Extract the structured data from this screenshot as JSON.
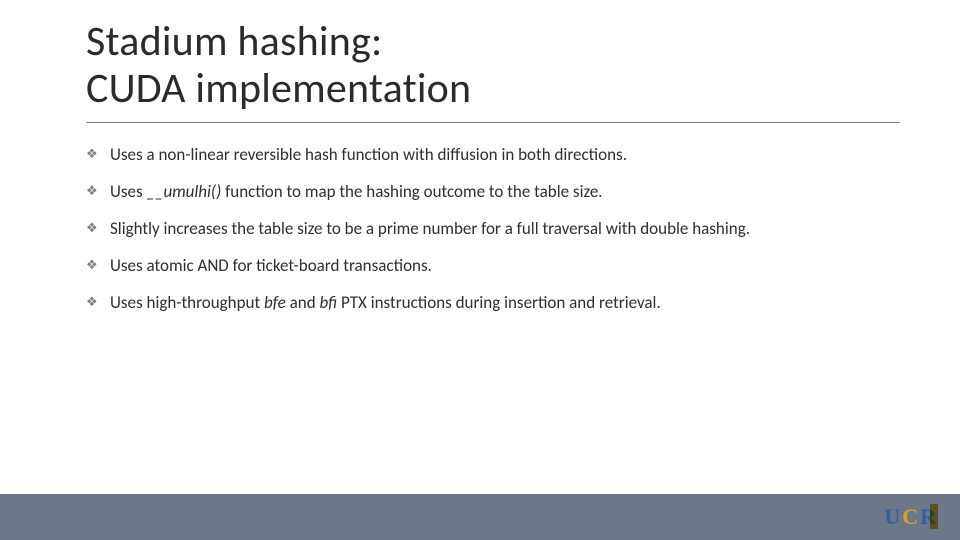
{
  "title": {
    "line1": "Stadium hashing:",
    "line2": "CUDA implementation"
  },
  "bullets": [
    {
      "prefix": "Uses a non-linear reversible hash function with diffusion in both directions."
    },
    {
      "prefix": "Uses ",
      "italic1": "__umulhi()",
      "mid": " function to map the hashing outcome to the table size."
    },
    {
      "prefix": "Slightly increases the table size to be a prime number for a full traversal with double hashing."
    },
    {
      "prefix": "Uses atomic AND for ticket-board transactions."
    },
    {
      "prefix": "Uses high-throughput ",
      "italic1": "bfe",
      "mid": " and ",
      "italic2": "bfi",
      "suffix": " PTX instructions during insertion and retrieval."
    }
  ],
  "icons": {
    "bullet_glyph": "❖"
  },
  "logo": {
    "u": "U",
    "c": "C",
    "r": "R"
  }
}
